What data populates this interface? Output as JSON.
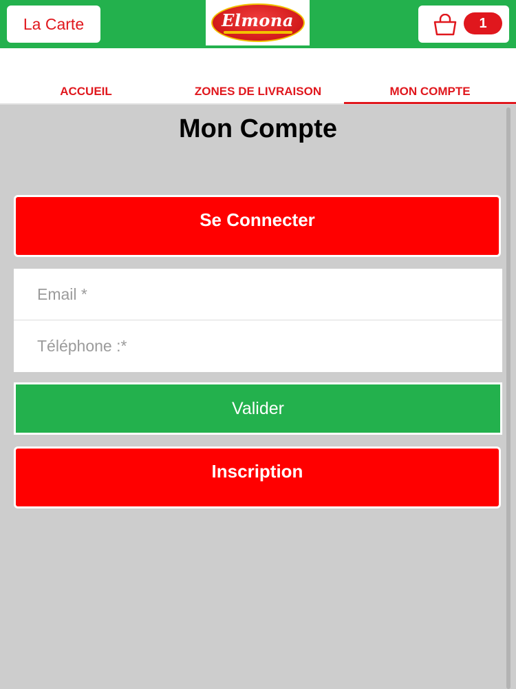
{
  "header": {
    "menu_label": "La Carte",
    "logo_text": "Elmona",
    "cart_count": "1",
    "brand_green": "#23b14d",
    "brand_red": "#e0171d",
    "cart_icon": "shopping-bag-icon"
  },
  "nav": {
    "tabs": [
      {
        "label": "ACCUEIL",
        "active": false
      },
      {
        "label": "ZONES DE LIVRAISON",
        "active": false
      },
      {
        "label": "MON COMPTE",
        "active": true
      }
    ]
  },
  "main": {
    "title": "Mon Compte",
    "connect_label": "Se Connecter",
    "email_placeholder": "Email *",
    "phone_placeholder": "Téléphone :*",
    "validate_label": "Valider",
    "signup_label": "Inscription"
  }
}
